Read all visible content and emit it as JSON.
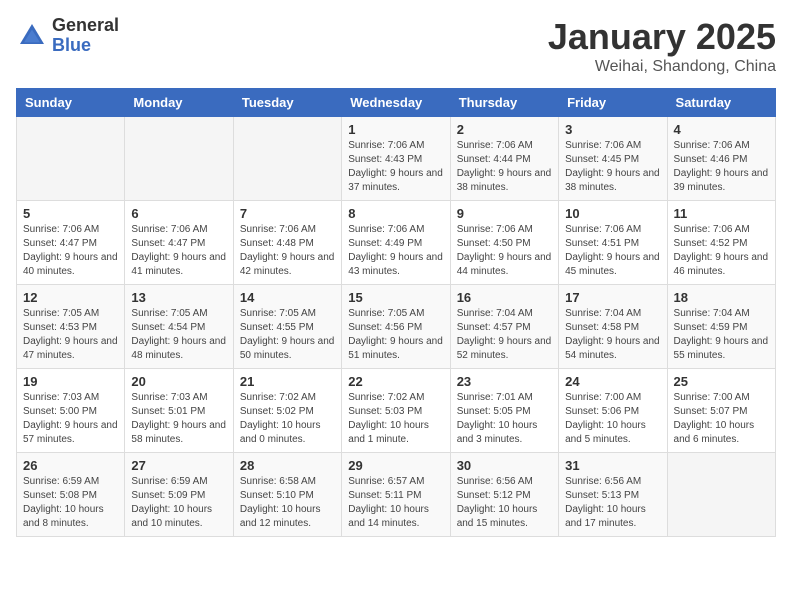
{
  "header": {
    "logo_general": "General",
    "logo_blue": "Blue",
    "title": "January 2025",
    "subtitle": "Weihai, Shandong, China"
  },
  "calendar": {
    "days_of_week": [
      "Sunday",
      "Monday",
      "Tuesday",
      "Wednesday",
      "Thursday",
      "Friday",
      "Saturday"
    ],
    "weeks": [
      [
        {
          "day": "",
          "info": ""
        },
        {
          "day": "",
          "info": ""
        },
        {
          "day": "",
          "info": ""
        },
        {
          "day": "1",
          "info": "Sunrise: 7:06 AM\nSunset: 4:43 PM\nDaylight: 9 hours and 37 minutes."
        },
        {
          "day": "2",
          "info": "Sunrise: 7:06 AM\nSunset: 4:44 PM\nDaylight: 9 hours and 38 minutes."
        },
        {
          "day": "3",
          "info": "Sunrise: 7:06 AM\nSunset: 4:45 PM\nDaylight: 9 hours and 38 minutes."
        },
        {
          "day": "4",
          "info": "Sunrise: 7:06 AM\nSunset: 4:46 PM\nDaylight: 9 hours and 39 minutes."
        }
      ],
      [
        {
          "day": "5",
          "info": "Sunrise: 7:06 AM\nSunset: 4:47 PM\nDaylight: 9 hours and 40 minutes."
        },
        {
          "day": "6",
          "info": "Sunrise: 7:06 AM\nSunset: 4:47 PM\nDaylight: 9 hours and 41 minutes."
        },
        {
          "day": "7",
          "info": "Sunrise: 7:06 AM\nSunset: 4:48 PM\nDaylight: 9 hours and 42 minutes."
        },
        {
          "day": "8",
          "info": "Sunrise: 7:06 AM\nSunset: 4:49 PM\nDaylight: 9 hours and 43 minutes."
        },
        {
          "day": "9",
          "info": "Sunrise: 7:06 AM\nSunset: 4:50 PM\nDaylight: 9 hours and 44 minutes."
        },
        {
          "day": "10",
          "info": "Sunrise: 7:06 AM\nSunset: 4:51 PM\nDaylight: 9 hours and 45 minutes."
        },
        {
          "day": "11",
          "info": "Sunrise: 7:06 AM\nSunset: 4:52 PM\nDaylight: 9 hours and 46 minutes."
        }
      ],
      [
        {
          "day": "12",
          "info": "Sunrise: 7:05 AM\nSunset: 4:53 PM\nDaylight: 9 hours and 47 minutes."
        },
        {
          "day": "13",
          "info": "Sunrise: 7:05 AM\nSunset: 4:54 PM\nDaylight: 9 hours and 48 minutes."
        },
        {
          "day": "14",
          "info": "Sunrise: 7:05 AM\nSunset: 4:55 PM\nDaylight: 9 hours and 50 minutes."
        },
        {
          "day": "15",
          "info": "Sunrise: 7:05 AM\nSunset: 4:56 PM\nDaylight: 9 hours and 51 minutes."
        },
        {
          "day": "16",
          "info": "Sunrise: 7:04 AM\nSunset: 4:57 PM\nDaylight: 9 hours and 52 minutes."
        },
        {
          "day": "17",
          "info": "Sunrise: 7:04 AM\nSunset: 4:58 PM\nDaylight: 9 hours and 54 minutes."
        },
        {
          "day": "18",
          "info": "Sunrise: 7:04 AM\nSunset: 4:59 PM\nDaylight: 9 hours and 55 minutes."
        }
      ],
      [
        {
          "day": "19",
          "info": "Sunrise: 7:03 AM\nSunset: 5:00 PM\nDaylight: 9 hours and 57 minutes."
        },
        {
          "day": "20",
          "info": "Sunrise: 7:03 AM\nSunset: 5:01 PM\nDaylight: 9 hours and 58 minutes."
        },
        {
          "day": "21",
          "info": "Sunrise: 7:02 AM\nSunset: 5:02 PM\nDaylight: 10 hours and 0 minutes."
        },
        {
          "day": "22",
          "info": "Sunrise: 7:02 AM\nSunset: 5:03 PM\nDaylight: 10 hours and 1 minute."
        },
        {
          "day": "23",
          "info": "Sunrise: 7:01 AM\nSunset: 5:05 PM\nDaylight: 10 hours and 3 minutes."
        },
        {
          "day": "24",
          "info": "Sunrise: 7:00 AM\nSunset: 5:06 PM\nDaylight: 10 hours and 5 minutes."
        },
        {
          "day": "25",
          "info": "Sunrise: 7:00 AM\nSunset: 5:07 PM\nDaylight: 10 hours and 6 minutes."
        }
      ],
      [
        {
          "day": "26",
          "info": "Sunrise: 6:59 AM\nSunset: 5:08 PM\nDaylight: 10 hours and 8 minutes."
        },
        {
          "day": "27",
          "info": "Sunrise: 6:59 AM\nSunset: 5:09 PM\nDaylight: 10 hours and 10 minutes."
        },
        {
          "day": "28",
          "info": "Sunrise: 6:58 AM\nSunset: 5:10 PM\nDaylight: 10 hours and 12 minutes."
        },
        {
          "day": "29",
          "info": "Sunrise: 6:57 AM\nSunset: 5:11 PM\nDaylight: 10 hours and 14 minutes."
        },
        {
          "day": "30",
          "info": "Sunrise: 6:56 AM\nSunset: 5:12 PM\nDaylight: 10 hours and 15 minutes."
        },
        {
          "day": "31",
          "info": "Sunrise: 6:56 AM\nSunset: 5:13 PM\nDaylight: 10 hours and 17 minutes."
        },
        {
          "day": "",
          "info": ""
        }
      ]
    ]
  }
}
